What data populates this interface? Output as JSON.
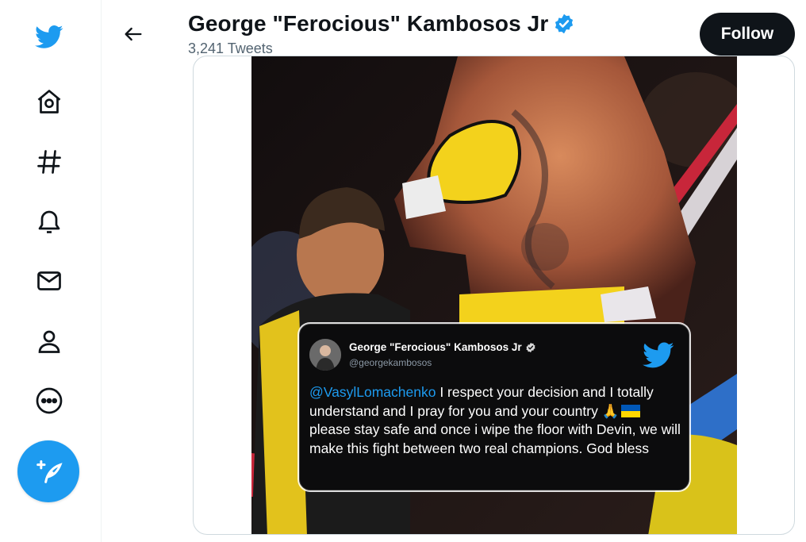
{
  "nav": {
    "items": [
      {
        "name": "twitter-logo-icon"
      },
      {
        "name": "home-icon"
      },
      {
        "name": "explore-hashtag-icon"
      },
      {
        "name": "notifications-bell-icon"
      },
      {
        "name": "messages-envelope-icon"
      },
      {
        "name": "profile-person-icon"
      },
      {
        "name": "more-ellipsis-icon"
      }
    ],
    "compose": {
      "name": "compose-tweet-icon"
    }
  },
  "header": {
    "title": "George \"Ferocious\" Kambosos Jr",
    "tweet_count": "3,241 Tweets",
    "follow_label": "Follow"
  },
  "quoted_tweet": {
    "name": "George \"Ferocious\" Kambosos Jr",
    "handle": "@georgekambosos",
    "mention": "@VasylLomachenko",
    "text_part1": " I respect your decision and I totally understand and I pray for you and your country ",
    "emoji_hands": "🙏",
    "text_part2": " please stay safe and once i wipe the floor with Devin, we will make this fight between two real champions. God bless"
  },
  "colors": {
    "accent": "#1d9bf0",
    "follow_bg": "#0f1419",
    "muted": "#536471",
    "ukraine_blue": "#0057b7",
    "ukraine_yellow": "#ffd700",
    "glove_yellow": "#f3d21c"
  }
}
